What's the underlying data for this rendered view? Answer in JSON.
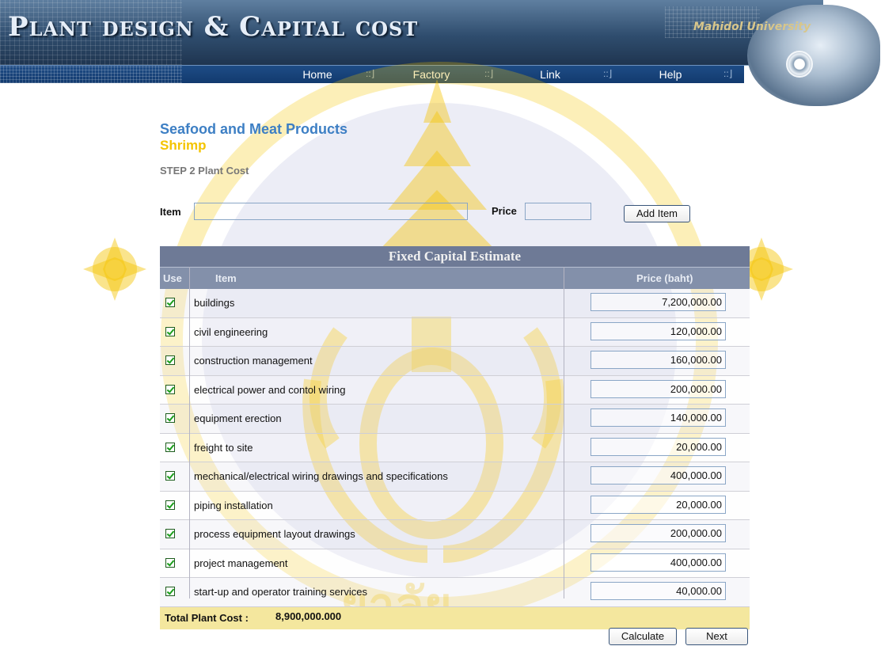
{
  "header": {
    "site_title": "Plant design & Capital cost",
    "university": "Mahidol University",
    "nav": [
      {
        "label": "Home"
      },
      {
        "label": "Factory"
      },
      {
        "label": "Link"
      },
      {
        "label": "Help"
      }
    ]
  },
  "page": {
    "category": "Seafood and Meat Products",
    "product": "Shrimp",
    "step": "STEP 2 Plant Cost"
  },
  "add_form": {
    "item_label": "Item",
    "item_value": "",
    "price_label": "Price",
    "price_value": "",
    "add_button": "Add Item"
  },
  "table": {
    "title": "Fixed Capital Estimate",
    "col_use": "Use",
    "col_item": "Item",
    "col_price": "Price (baht)",
    "rows": [
      {
        "item": "buildings",
        "price": "7,200,000.00",
        "checked": true
      },
      {
        "item": "civil engineering",
        "price": "120,000.00",
        "checked": true
      },
      {
        "item": "construction management",
        "price": "160,000.00",
        "checked": true
      },
      {
        "item": "electrical power and contol wiring",
        "price": "200,000.00",
        "checked": true
      },
      {
        "item": "equipment erection",
        "price": "140,000.00",
        "checked": true
      },
      {
        "item": "freight to site",
        "price": "20,000.00",
        "checked": true
      },
      {
        "item": "mechanical/electrical wiring drawings and specifications",
        "price": "400,000.00",
        "checked": true
      },
      {
        "item": "piping installation",
        "price": "20,000.00",
        "checked": true
      },
      {
        "item": "process equipment layout drawings",
        "price": "200,000.00",
        "checked": true
      },
      {
        "item": "project management",
        "price": "400,000.00",
        "checked": true
      },
      {
        "item": "start-up and operator training services",
        "price": "40,000.00",
        "checked": true
      }
    ],
    "total_label": "Total Plant Cost :",
    "total_value": "8,900,000.000"
  },
  "actions": {
    "calculate": "Calculate",
    "next": "Next"
  },
  "colors": {
    "watermark": "#f5c400",
    "category": "#3d7fc4",
    "product": "#f4c400",
    "table_header": "#6e7a96",
    "total_bg": "#f4e79e"
  }
}
